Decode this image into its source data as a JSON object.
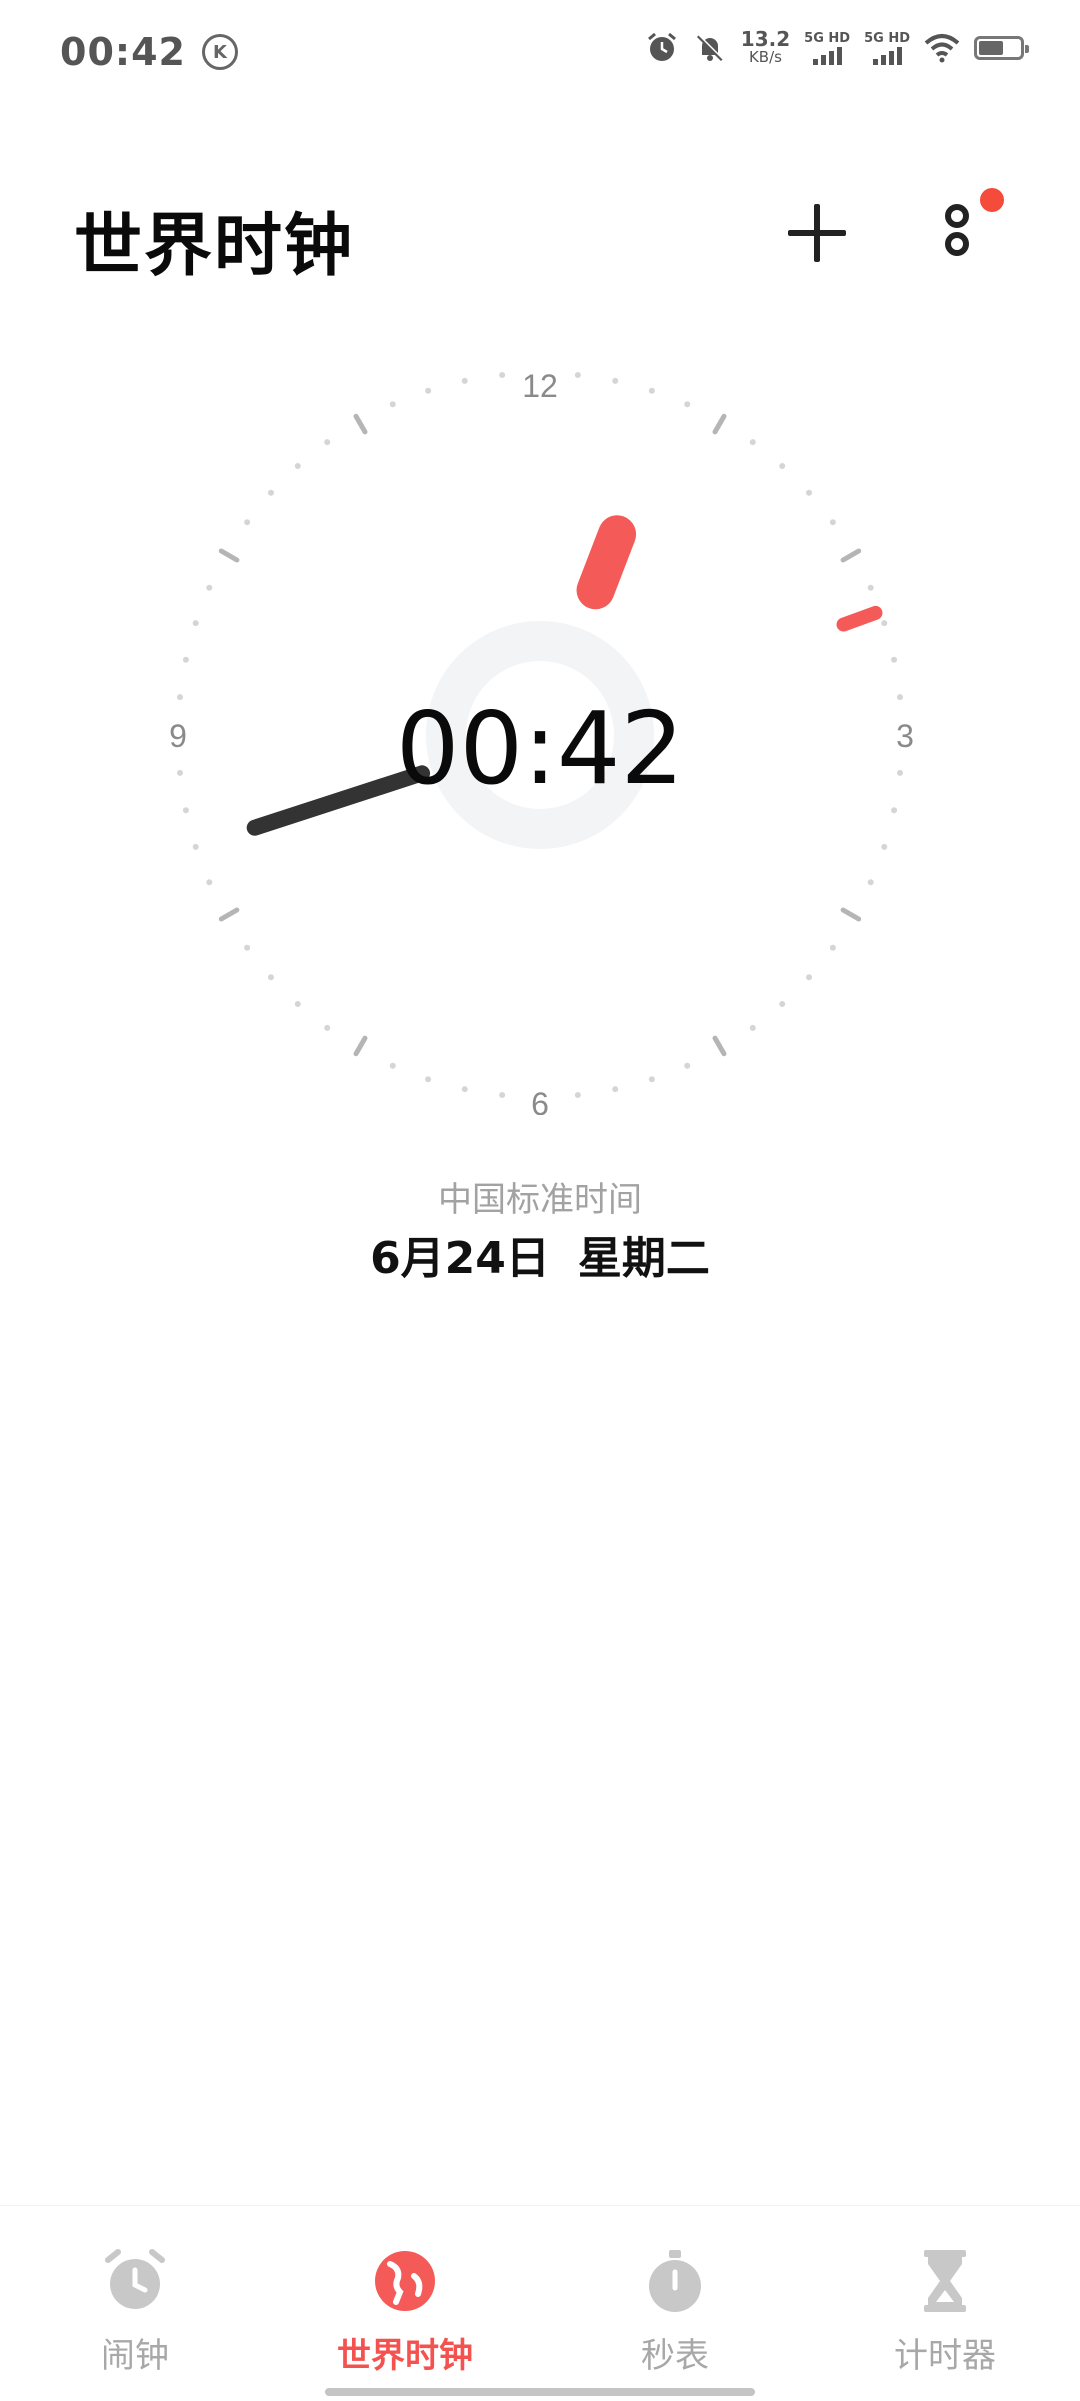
{
  "status_bar": {
    "time": "00:42",
    "k_badge": "K",
    "net_speed_value": "13.2",
    "net_speed_unit": "KB/s",
    "sim1_label": "5G HD",
    "sim2_label": "5G HD",
    "icons": [
      "alarm-icon",
      "mute-icon",
      "wifi-icon",
      "battery-icon"
    ]
  },
  "header": {
    "title": "世界时钟",
    "add_icon": "plus-icon",
    "more_icon": "more-icon"
  },
  "clock": {
    "numerals": {
      "n12": "12",
      "n3": "3",
      "n6": "6",
      "n9": "9"
    },
    "digital_time": "00:42",
    "hour": 0,
    "minute": 42,
    "accent_color": "#f45a58",
    "hand_color": "#333333"
  },
  "timezone": "中国标准时间",
  "date": {
    "day": "6月24日",
    "weekday": "星期二"
  },
  "nav": {
    "items": [
      {
        "label": "闹钟",
        "icon": "alarm-clock-icon",
        "active": false
      },
      {
        "label": "世界时钟",
        "icon": "globe-icon",
        "active": true
      },
      {
        "label": "秒表",
        "icon": "stopwatch-icon",
        "active": false
      },
      {
        "label": "计时器",
        "icon": "hourglass-icon",
        "active": false
      }
    ]
  }
}
